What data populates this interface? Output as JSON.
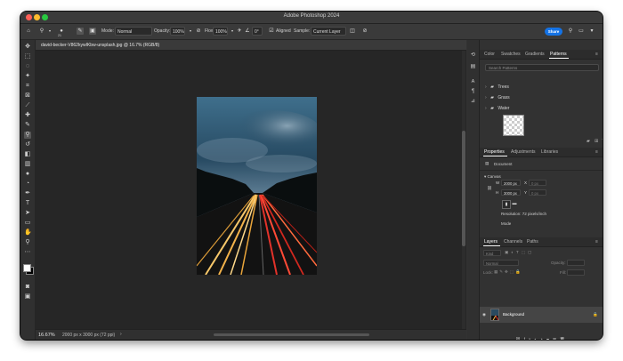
{
  "window": {
    "title": "Adobe Photoshop 2024"
  },
  "options_bar": {
    "tool_size": "21",
    "mode_label": "Mode:",
    "mode_value": "Normal",
    "opacity_label": "Opacity:",
    "opacity_value": "100%",
    "flow_label": "Flow:",
    "flow_value": "100%",
    "angle_value": "0°",
    "aligned_label": "Aligned",
    "sample_label": "Sample:",
    "sample_value": "Current Layer",
    "share_label": "Share"
  },
  "document": {
    "tab_label": "david-becker-V862kywIKbw-unsplash.jpg @ 16.7% (RGB/8)",
    "zoom": "16.67%",
    "size_info": "2000 px x 3000 px (72 ppi)"
  },
  "patterns_panel": {
    "tabs": [
      "Color",
      "Swatches",
      "Gradients",
      "Patterns"
    ],
    "active_tab": "Patterns",
    "search_placeholder": "Search Patterns",
    "groups": [
      "Trees",
      "Grass",
      "Water"
    ]
  },
  "properties_panel": {
    "tabs": [
      "Properties",
      "Adjustments",
      "Libraries"
    ],
    "active_tab": "Properties",
    "type_label": "Document",
    "canvas_label": "Canvas",
    "w_label": "W",
    "w_value": "2000 px",
    "h_label": "H",
    "h_value": "3000 px",
    "x_label": "X",
    "x_value": "0 px",
    "y_label": "Y",
    "y_value": "0 px",
    "resolution": "Resolution: 72 pixels/inch",
    "mode_label": "Mode"
  },
  "layers_panel": {
    "tabs": [
      "Layers",
      "Channels",
      "Paths"
    ],
    "active_tab": "Layers",
    "kind_label": "Kind",
    "blend_value": "Normal",
    "opacity_label": "Opacity:",
    "lock_label": "Lock:",
    "fill_label": "Fill:",
    "layer_name": "Background"
  },
  "colors": {
    "accent": "#1473e6",
    "panel_bg": "#323232",
    "canvas_bg": "#262626"
  }
}
